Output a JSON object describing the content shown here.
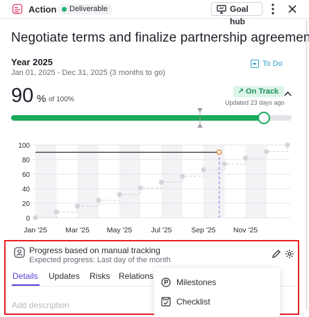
{
  "header": {
    "type_label": "Action",
    "status_label": "Deliverable",
    "goal_hub_label": "Goal hub",
    "icons": [
      "action-icon",
      "goal-hub-icon",
      "more-icon",
      "close-icon"
    ]
  },
  "goal": {
    "title": "Negotiate terms and finalize partnership agreements",
    "period": "Year 2025",
    "date_range": "Jan 01, 2025 - Dec 31, 2025 (3 months to go)",
    "todo_label": "To Do",
    "progress_value": "90",
    "progress_unit": "%",
    "progress_of": "of 100%",
    "progress_fraction": 0.9,
    "expected_fraction": 0.675,
    "track_status": "On Track",
    "updated": "Updated 23 days ago"
  },
  "colors": {
    "accent": "#5b3bd6",
    "on_track_green": "#1aaa5c",
    "todo_blue": "#2aa2c7",
    "highlight_red": "#e32020"
  },
  "chart_data": {
    "type": "line",
    "x_ticks": [
      "Jan '25",
      "Mar '25",
      "May '25",
      "Jul '25",
      "Sep '25",
      "Nov '25"
    ],
    "y_ticks": [
      0,
      20,
      40,
      60,
      80,
      100
    ],
    "ylim": [
      0,
      100
    ],
    "xlim": [
      0,
      12
    ],
    "grid": true,
    "series": [
      {
        "kind": "expected",
        "x": [
          0,
          1,
          2,
          3,
          4,
          5,
          6,
          7,
          8,
          9,
          10,
          11,
          12
        ],
        "y": [
          0,
          8,
          16,
          24,
          32,
          41,
          49,
          57,
          66,
          74,
          82,
          91,
          100
        ]
      },
      {
        "kind": "actual",
        "x": [
          0,
          8.75
        ],
        "y": [
          90,
          90
        ]
      }
    ],
    "today_x": 8.75
  },
  "tracking": {
    "title": "Progress based on manual tracking",
    "subtitle": "Expected progress: Last day of the month",
    "tabs": [
      "Details",
      "Updates",
      "Risks",
      "Relations"
    ],
    "active_tab": "Details",
    "description_placeholder": "Add description"
  },
  "menu": {
    "items": [
      {
        "label": "Milestones",
        "icon": "milestones-icon"
      },
      {
        "label": "Checklist",
        "icon": "checklist-icon"
      }
    ]
  }
}
